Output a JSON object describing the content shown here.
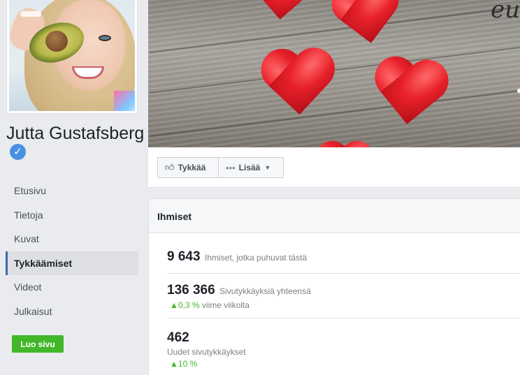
{
  "page": {
    "name": "Jutta Gustafsberg",
    "verified_icon": "verified-check-icon"
  },
  "nav": {
    "items": [
      {
        "label": "Etusivu"
      },
      {
        "label": "Tietoja"
      },
      {
        "label": "Kuvat"
      },
      {
        "label": "Tykkäämiset",
        "active": true
      },
      {
        "label": "Videot"
      },
      {
        "label": "Julkaisut"
      }
    ],
    "create_label": "Luo sivu"
  },
  "actions": {
    "like_label": "Tykkää",
    "more_label": "Lisää"
  },
  "people": {
    "title": "Ihmiset",
    "talking": {
      "value": "9 643",
      "label": "Ihmiset, jotka puhuvat tästä"
    },
    "total_likes": {
      "value": "136 366",
      "label": "Sivutykkäyksiä yhteensä",
      "change": "0,3 %",
      "change_suffix": "viime viikolta"
    },
    "new_likes": {
      "value": "462",
      "label": "Uudet sivutykkäykset",
      "change": "10 %"
    }
  },
  "colors": {
    "accent": "#4267b2",
    "positive": "#42b72a",
    "verified": "#4a90e2"
  }
}
